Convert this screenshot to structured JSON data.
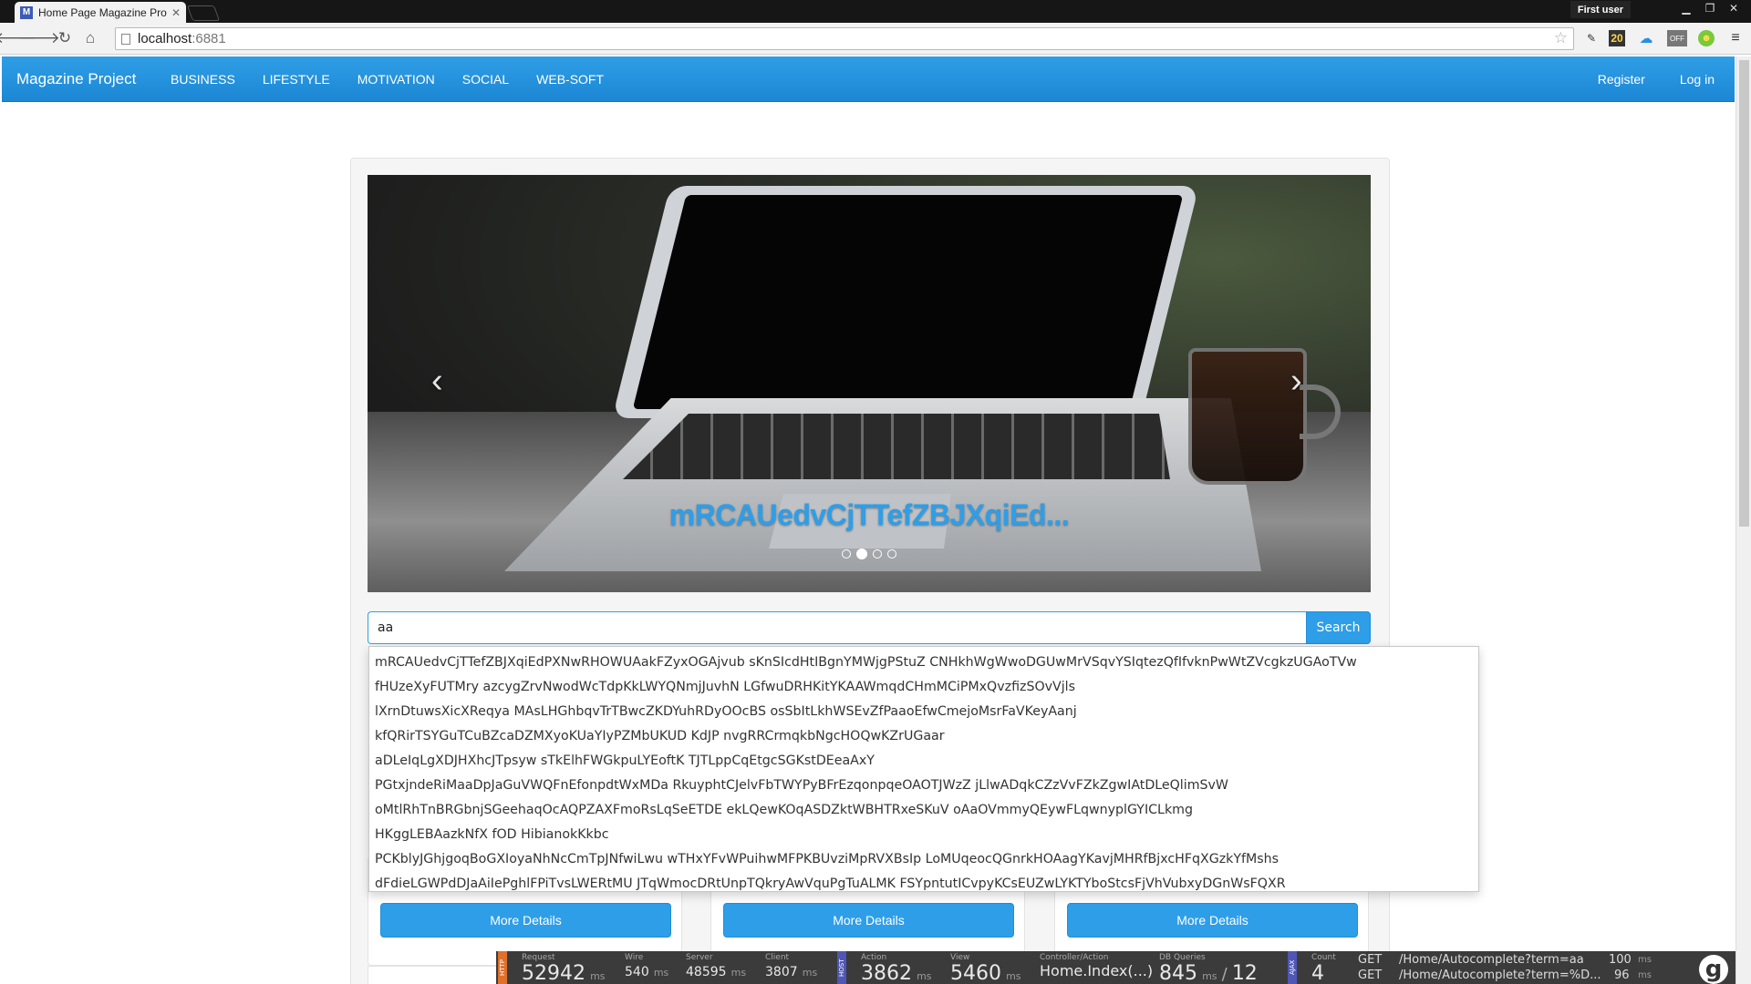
{
  "browser": {
    "tab_title": "Home Page Magazine Pro",
    "tab_close": "✕",
    "user_badge": "First user",
    "address_host": "localhost",
    "address_port": ":6881",
    "extension_badge": "20",
    "extension_off": "OFF"
  },
  "navbar": {
    "brand": "Magazine Project",
    "links": [
      "BUSINESS",
      "LIFESTYLE",
      "MOTIVATION",
      "SOCIAL",
      "WEB-SOFT"
    ],
    "register": "Register",
    "login": "Log in"
  },
  "carousel": {
    "caption": "mRCAUedvCjTTefZBJXqiEd...",
    "prev_arrow": "‹",
    "next_arrow": "›",
    "slide_count": 4,
    "active_index": 1
  },
  "search": {
    "value": "aa",
    "button_label": "Search"
  },
  "autocomplete": {
    "items": [
      "mRCAUedvCjTTefZBJXqiEdPXNwRHOWUAakFZyxOGAjvub sKnSIcdHtIBgnYMWjgPStuZ CNHkhWgWwoDGUwMrVSqvYSIqtezQfIfvknPwWtZVcgkzUGAoTVw",
      "fHUzeXyFUTMry azcygZrvNwodWcTdpKkLWYQNmjJuvhN LGfwuDRHKitYKAAWmqdCHmMCiPMxQvzfizSOvVjls",
      "lXrnDtuwsXicXReqya MAsLHGhbqvTrTBwcZKDYuhRDyOOcBS osSbItLkhWSEvZfPaaoEfwCmejoMsrFaVKeyAanj",
      "kfQRirTSYGuTCuBZcaDZMXyoKUaYIyPZMbUKUD KdJP nvgRRCrmqkbNgcHOQwKZrUGaar",
      "aDLeIqLgXDJHXhcJTpsyw sTkElhFWGkpuLYEoftK TJTLppCqEtgcSGKstDEeaAxY",
      "PGtxjndeRiMaaDpJaGuVWQFnEfonpdtWxMDa RkuyphtCJelvFbTWYPyBFrEzqonpqeOAOTJWzZ jLlwADqkCZzVvFZkZgwIAtDLeQlimSvW",
      "oMtlRhTnBRGbnjSGeehaqOcAQPZAXFmoRsLqSeETDE ekLQewKOqASDZktWBHTRxeSKuV oAaOVmmyQEywFLqwnyplGYICLkmg",
      "HKggLEBAazkNfX fOD HibianokKkbc",
      "PCKblyJGhjgoqBoGXIoyaNhNcCmTpJNfwiLwu wTHxYFvWPuihwMFPKBUvziMpRVXBsIp LoMUqeocQGnrkHOAagYKavjMHRfBjxcHFqXGzkYfMshs",
      "dFdieLGWPdDJaAiIePghlFPiTvsLWERtMU JTqWmocDRtUnpTQkryAwVquPgTuALMK FSYpntutICvpyKCsEUZwLYKTYboStcsFjVhVubxyDGnWsFQXR"
    ]
  },
  "cards": {
    "button_label": "More Details"
  },
  "profiler": {
    "tag_http": "HTTP",
    "tag_host": "HOST",
    "tag_ajax": "AJAX",
    "request_label": "Request",
    "request_value": "52942",
    "request_unit": "ms",
    "wire_label": "Wire",
    "wire_value": "540",
    "wire_unit": "ms",
    "server_label": "Server",
    "server_value": "48595",
    "server_unit": "ms",
    "client_label": "Client",
    "client_value": "3807",
    "client_unit": "ms",
    "action_label": "Action",
    "action_value": "3862",
    "action_unit": "ms",
    "view_label": "View",
    "view_value": "5460",
    "view_unit": "ms",
    "controller_label": "Controller/Action",
    "controller_value": "Home.Index(...)",
    "db_label": "DB Queries",
    "db_time": "845",
    "db_unit": "ms",
    "db_sep": "/",
    "db_count": "12",
    "count_label": "Count",
    "count_value": "4",
    "requests": [
      {
        "method": "GET",
        "url": "/Home/Autocomplete?term=aa",
        "time": "100",
        "unit": "ms"
      },
      {
        "method": "GET",
        "url": "/Home/Autocomplete?term=%D...",
        "time": "96",
        "unit": "ms"
      }
    ],
    "logo": "g"
  },
  "colors": {
    "accent": "#2e9ee8",
    "navbar": "#1c87d4",
    "profiler_bg": "#3b3b3b"
  }
}
